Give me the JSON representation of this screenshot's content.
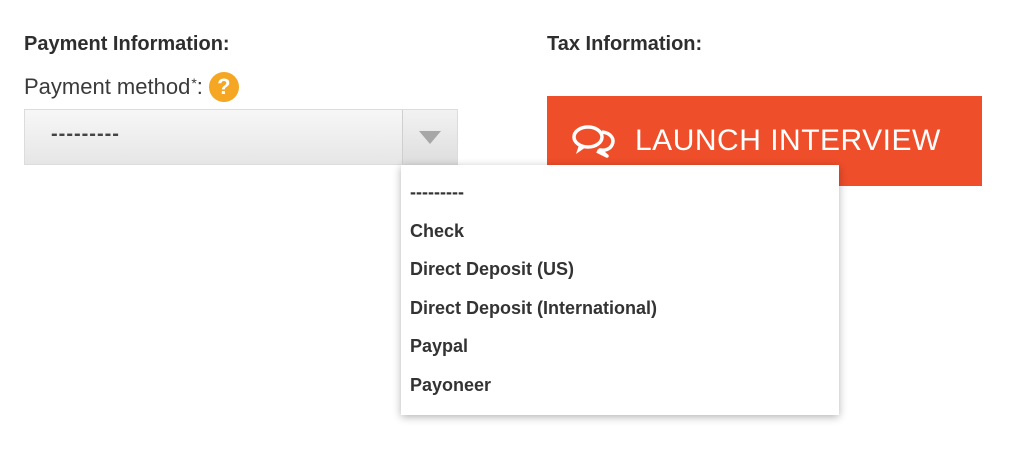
{
  "payment": {
    "heading": "Payment Information:",
    "method_label": "Payment method",
    "required_mark": "*",
    "label_suffix": ":",
    "help_glyph": "?",
    "help_icon": "question-circle-icon",
    "selected_value": "---------",
    "options": [
      "---------",
      "Check",
      "Direct Deposit (US)",
      "Direct Deposit (International)",
      "Paypal",
      "Payoneer"
    ]
  },
  "tax": {
    "heading": "Tax Information:",
    "launch_label": "LAUNCH INTERVIEW",
    "launch_icon": "chat-bubbles-icon"
  },
  "colors": {
    "accent": "#ef4e2a",
    "help_icon": "#f5a623",
    "text": "#333333"
  }
}
